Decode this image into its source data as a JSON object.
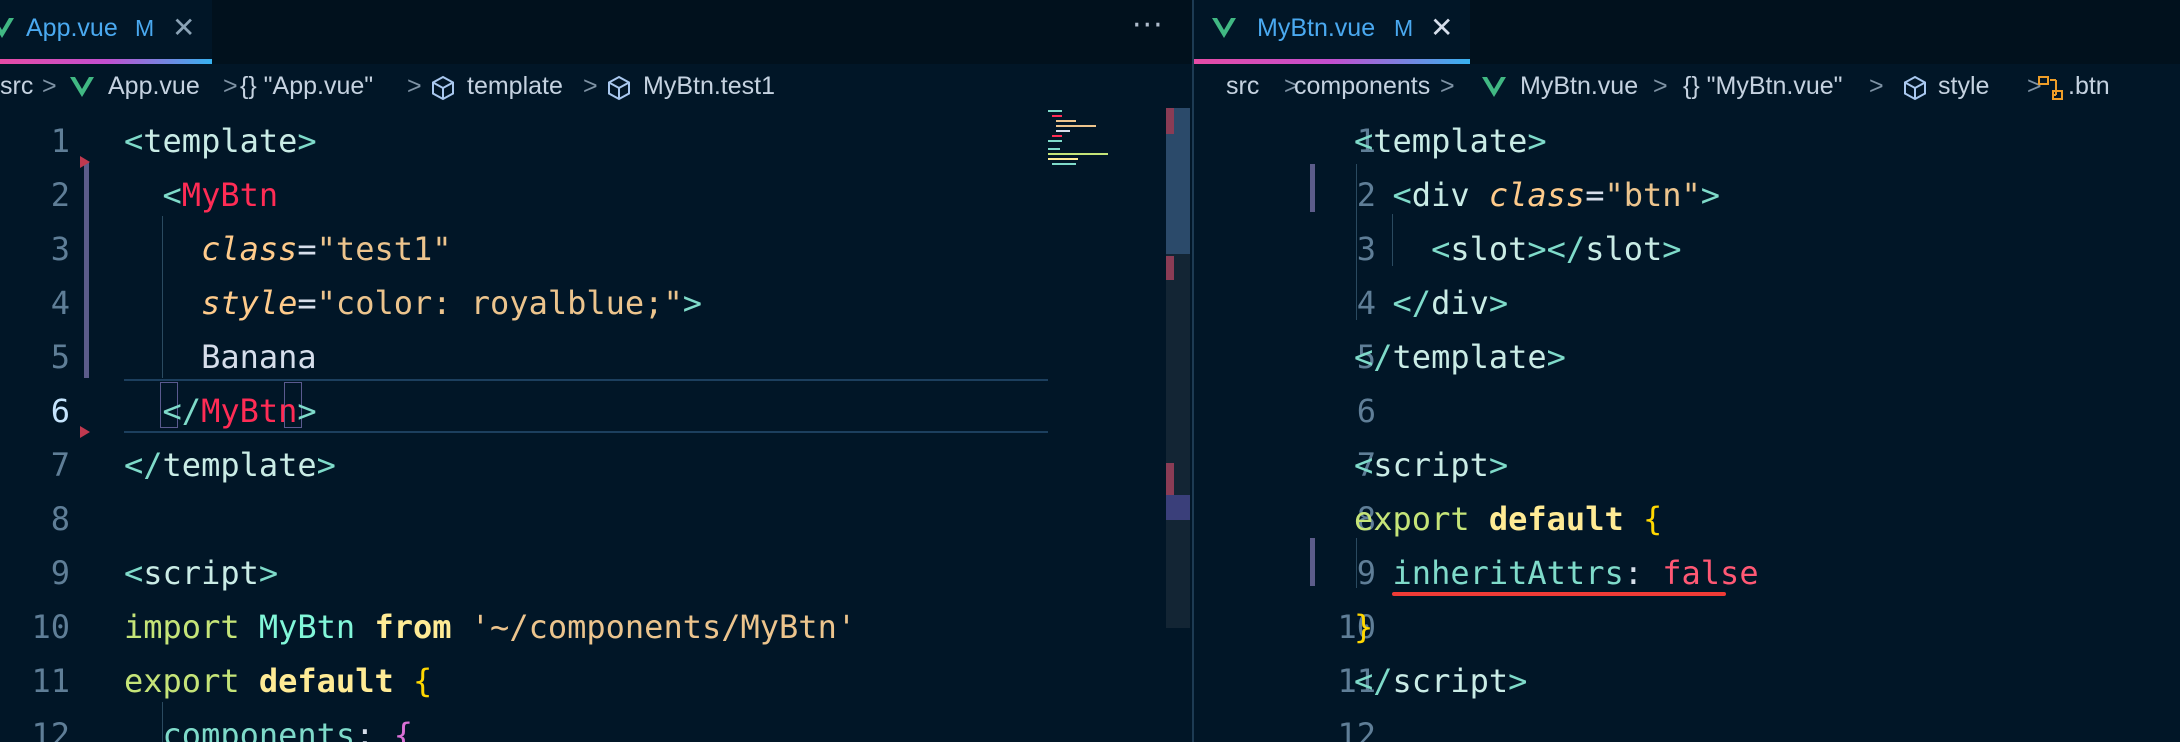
{
  "left": {
    "tab": {
      "label": "App.vue",
      "status": "M"
    },
    "more_label": "···",
    "breadcrumb": {
      "items": [
        "src",
        "App.vue",
        "{} \"App.vue\"",
        "template",
        "MyBtn.test1"
      ],
      "separator": ">"
    },
    "lines": [
      {
        "n": "1",
        "tokens": [
          [
            "t-punc",
            "<"
          ],
          [
            "t-tag",
            "template"
          ],
          [
            "t-punc",
            ">"
          ]
        ]
      },
      {
        "n": "2",
        "tokens": [
          [
            "t-plain",
            "  "
          ],
          [
            "t-punc",
            "<"
          ],
          [
            "t-comp",
            "MyBtn"
          ]
        ]
      },
      {
        "n": "3",
        "tokens": [
          [
            "t-plain",
            "    "
          ],
          [
            "t-attr",
            "class"
          ],
          [
            "t-eq",
            "="
          ],
          [
            "t-str",
            "\"test1\""
          ]
        ]
      },
      {
        "n": "4",
        "tokens": [
          [
            "t-plain",
            "    "
          ],
          [
            "t-attr",
            "style"
          ],
          [
            "t-eq",
            "="
          ],
          [
            "t-str",
            "\"color: royalblue;\""
          ],
          [
            "t-punc",
            ">"
          ]
        ]
      },
      {
        "n": "5",
        "tokens": [
          [
            "t-plain",
            "    Banana"
          ]
        ]
      },
      {
        "n": "6",
        "tokens": [
          [
            "t-plain",
            "  "
          ],
          [
            "t-punc",
            "</"
          ],
          [
            "t-comp",
            "MyBtn"
          ],
          [
            "t-punc",
            ">"
          ]
        ]
      },
      {
        "n": "7",
        "tokens": [
          [
            "t-punc",
            "</"
          ],
          [
            "t-tag",
            "template"
          ],
          [
            "t-punc",
            ">"
          ]
        ]
      },
      {
        "n": "8",
        "tokens": []
      },
      {
        "n": "9",
        "tokens": [
          [
            "t-punc",
            "<"
          ],
          [
            "t-tag",
            "script"
          ],
          [
            "t-punc",
            ">"
          ]
        ]
      },
      {
        "n": "10",
        "tokens": [
          [
            "t-kw",
            "import "
          ],
          [
            "t-class",
            "MyBtn"
          ],
          [
            "t-bold",
            " from "
          ],
          [
            "t-str",
            "'~/components/MyBtn'"
          ]
        ]
      },
      {
        "n": "11",
        "tokens": [
          [
            "t-kw",
            "export "
          ],
          [
            "t-bold",
            "default "
          ],
          [
            "t-brace",
            "{"
          ]
        ]
      },
      {
        "n": "12",
        "tokens": [
          [
            "t-plain",
            "  "
          ],
          [
            "t-prop",
            "components"
          ],
          [
            "t-plain",
            ": "
          ],
          [
            "t-brace2",
            "{"
          ]
        ]
      }
    ]
  },
  "right": {
    "tab": {
      "label": "MyBtn.vue",
      "status": "M"
    },
    "breadcrumb": {
      "items": [
        "src",
        "components",
        "MyBtn.vue",
        "{} \"MyBtn.vue\"",
        "style",
        ".btn"
      ],
      "separator": ">"
    },
    "lines": [
      {
        "n": "1",
        "tokens": [
          [
            "t-punc",
            "<"
          ],
          [
            "t-tag",
            "template"
          ],
          [
            "t-punc",
            ">"
          ]
        ]
      },
      {
        "n": "2",
        "tokens": [
          [
            "t-plain",
            "  "
          ],
          [
            "t-punc",
            "<"
          ],
          [
            "t-tag",
            "div "
          ],
          [
            "t-attr",
            "class"
          ],
          [
            "t-eq",
            "="
          ],
          [
            "t-str",
            "\"btn\""
          ],
          [
            "t-punc",
            ">"
          ]
        ]
      },
      {
        "n": "3",
        "tokens": [
          [
            "t-plain",
            "    "
          ],
          [
            "t-punc",
            "<"
          ],
          [
            "t-tag",
            "slot"
          ],
          [
            "t-punc",
            "></"
          ],
          [
            "t-tag",
            "slot"
          ],
          [
            "t-punc",
            ">"
          ]
        ]
      },
      {
        "n": "4",
        "tokens": [
          [
            "t-plain",
            "  "
          ],
          [
            "t-punc",
            "</"
          ],
          [
            "t-tag",
            "div"
          ],
          [
            "t-punc",
            ">"
          ]
        ]
      },
      {
        "n": "5",
        "tokens": [
          [
            "t-punc",
            "</"
          ],
          [
            "t-tag",
            "template"
          ],
          [
            "t-punc",
            ">"
          ]
        ]
      },
      {
        "n": "6",
        "tokens": []
      },
      {
        "n": "7",
        "tokens": [
          [
            "t-punc",
            "<"
          ],
          [
            "t-tag",
            "script"
          ],
          [
            "t-punc",
            ">"
          ]
        ]
      },
      {
        "n": "8",
        "tokens": [
          [
            "t-kw",
            "export "
          ],
          [
            "t-bold",
            "default "
          ],
          [
            "t-brace",
            "{"
          ]
        ]
      },
      {
        "n": "9",
        "tokens": [
          [
            "t-plain",
            "  "
          ],
          [
            "t-prop",
            "inheritAttrs"
          ],
          [
            "t-plain",
            ": "
          ],
          [
            "t-false",
            "false"
          ]
        ]
      },
      {
        "n": "10",
        "tokens": [
          [
            "t-brace",
            "}"
          ]
        ]
      },
      {
        "n": "11",
        "tokens": [
          [
            "t-punc",
            "</"
          ],
          [
            "t-tag",
            "script"
          ],
          [
            "t-punc",
            ">"
          ]
        ]
      },
      {
        "n": "12",
        "tokens": []
      }
    ]
  },
  "colors": {
    "background": "#011627",
    "accent": "#4aa9f0",
    "error": "#ef3b36"
  },
  "icons": [
    "vue-icon",
    "close-icon",
    "more-actions-icon",
    "braces-icon",
    "cube-icon",
    "style-rule-icon"
  ]
}
